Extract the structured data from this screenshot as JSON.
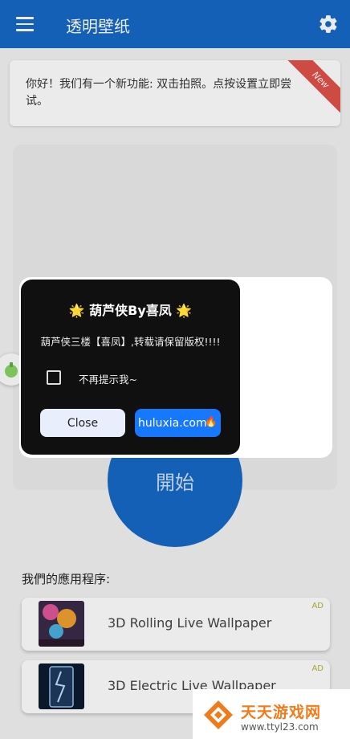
{
  "app_bar": {
    "title": "透明壁纸",
    "menu_icon": "menu-icon",
    "settings_icon": "gear-icon"
  },
  "notice": {
    "text": "你好！我们有一个新功能: 双击拍照。点按设置立即尝试。",
    "badge": "New"
  },
  "start_button": {
    "label": "開始"
  },
  "apps": {
    "heading": "我們的應用程序:",
    "items": [
      {
        "name": "3D Rolling Live Wallpaper",
        "badge": "AD"
      },
      {
        "name": "3D Electric Live Wallpaper",
        "badge": "AD"
      }
    ]
  },
  "dialog": {
    "title": "🌟 葫芦侠By喜凤 🌟",
    "message": "葫芦侠三楼【喜凤】,转载请保留版权!!!!",
    "checkbox_label": "不再提示我~",
    "close_label": "Close",
    "link_label": "huluxia.com",
    "link_icon": "fire-icon"
  },
  "watermark": {
    "title": "天天游戏网",
    "url": "www.ttyl23.com"
  },
  "colors": {
    "primary": "#1769c7",
    "ribbon": "#e0524a",
    "link_button": "#1677ff",
    "dialog_bg": "#101010"
  }
}
